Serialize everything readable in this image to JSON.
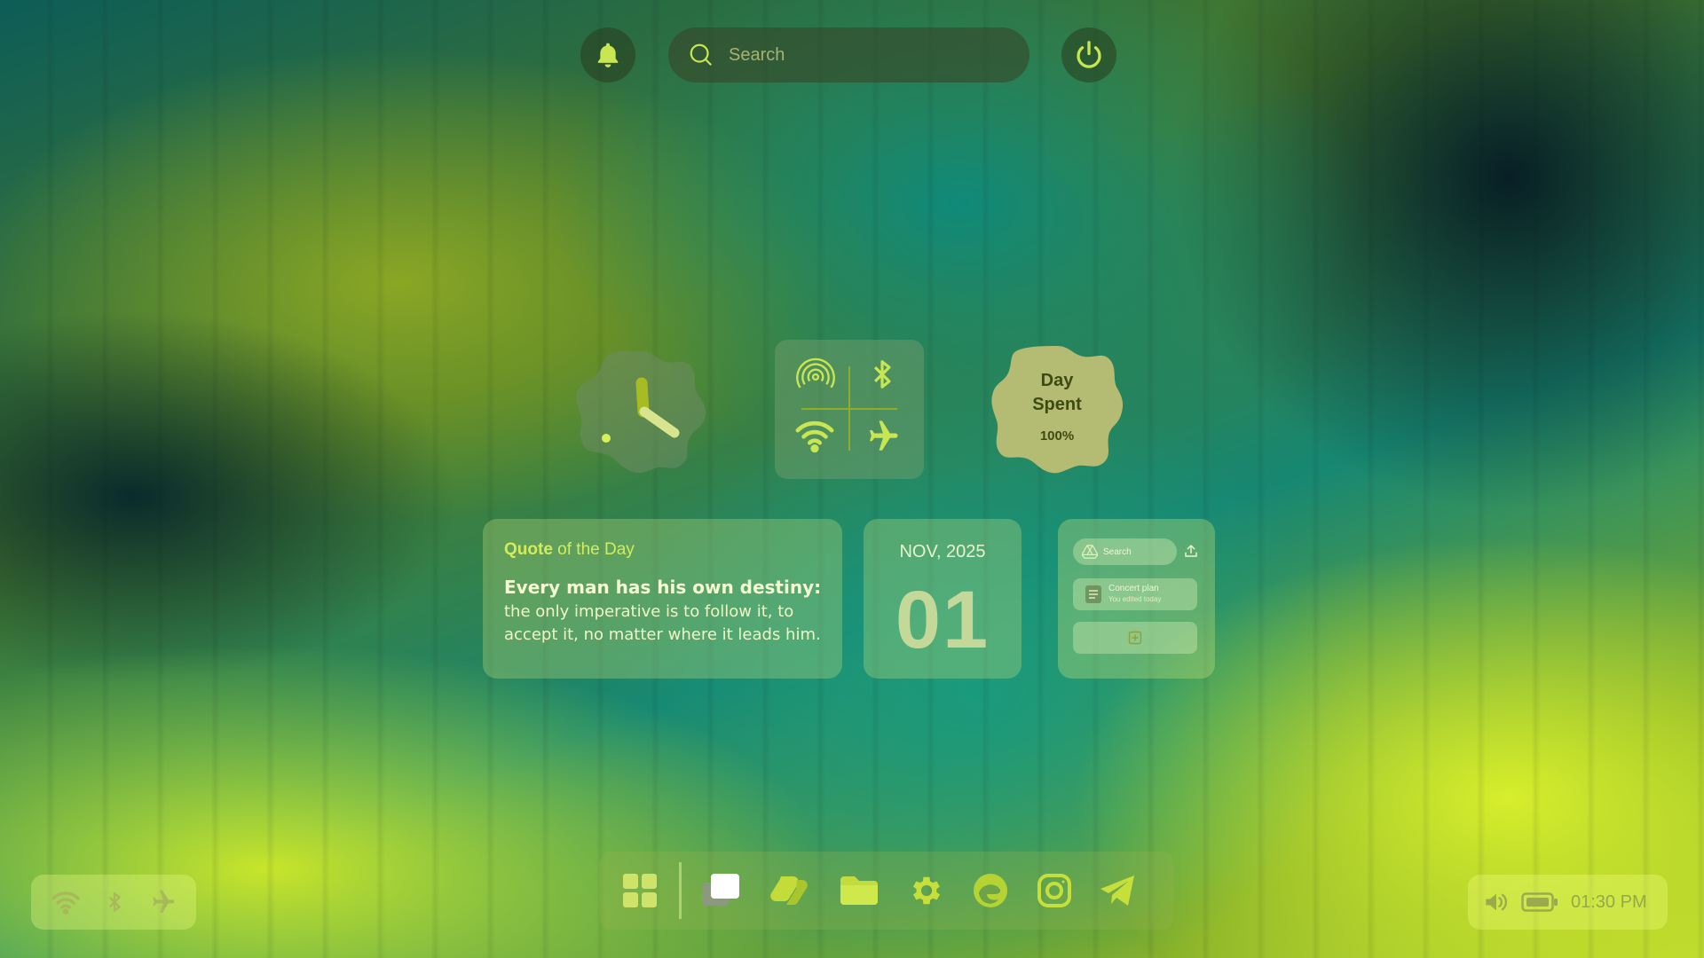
{
  "topbar": {
    "notifications_icon": "bell-icon",
    "search_placeholder": "Search",
    "power_icon": "power-icon"
  },
  "widgets": {
    "clock": {
      "icon": "analog-clock"
    },
    "quick_toggles": [
      "hotspot-icon",
      "bluetooth-icon",
      "wifi-icon",
      "airplane-icon"
    ],
    "day_spent": {
      "label_line1": "Day",
      "label_line2": "Spent",
      "percent": "100%"
    },
    "quote": {
      "title_bold": "Quote",
      "title_rest": " of the Day",
      "lead": "Every man has his own destiny:",
      "body": " the only imperative is to follow it, to accept it, no matter where it leads him."
    },
    "date": {
      "month_year": "NOV, 2025",
      "day": "01"
    },
    "drive": {
      "search_label": "Search",
      "file_name": "Concert plan",
      "file_sub": "You edited today"
    }
  },
  "taskbar": {
    "apps": [
      "start-icon",
      "task-view-icon",
      "copilot-icon",
      "file-explorer-icon",
      "settings-icon",
      "edge-icon",
      "instagram-icon",
      "telegram-icon"
    ]
  },
  "tray_left": [
    "wifi-icon",
    "bluetooth-icon",
    "airplane-icon"
  ],
  "tray_right": {
    "time": "01:30 PM"
  },
  "colors": {
    "accent": "#c8e552",
    "teal": "#138572",
    "lime": "#d6ee2c"
  }
}
